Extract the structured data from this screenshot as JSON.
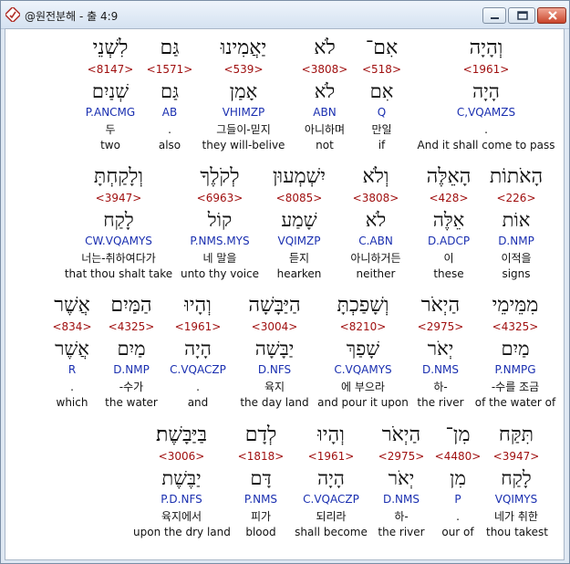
{
  "window": {
    "title": "@원전분해 - 출 4:9"
  },
  "rows": [
    [
      {
        "heb": "וְהָיָה",
        "strong": "<1961>",
        "lemma": "הָיָה",
        "parse": "C,VQAMZS",
        "kor": ".",
        "eng": "And it shall come to pass"
      },
      {
        "heb": "אִם־",
        "strong": "<518>",
        "lemma": "אִם",
        "parse": "Q",
        "kor": "만일",
        "eng": "if"
      },
      {
        "heb": "לֹא",
        "strong": "<3808>",
        "lemma": "לֹא",
        "parse": "ABN",
        "kor": "아니하며",
        "eng": "not"
      },
      {
        "heb": "יַאֲמִינוּ",
        "strong": "<539>",
        "lemma": "אָמַן",
        "parse": "VHIMZP",
        "kor": "그들이-믿지",
        "eng": "they will-belive"
      },
      {
        "heb": "גַּם",
        "strong": "<1571>",
        "lemma": "גַּם",
        "parse": "AB",
        "kor": ".",
        "eng": "also"
      },
      {
        "heb": "לִשְׁנֵי",
        "strong": "<8147>",
        "lemma": "שְׁנַיִם",
        "parse": "P.ANCMG",
        "kor": "두",
        "eng": "two"
      }
    ],
    [
      {
        "heb": "הָאֹתוֹת",
        "strong": "<226>",
        "lemma": "אוֹת",
        "parse": "D.NMP",
        "kor": "이적을",
        "eng": "signs"
      },
      {
        "heb": "הָאֵלֶּה",
        "strong": "<428>",
        "lemma": "אֵלֶּה",
        "parse": "D.ADCP",
        "kor": "이",
        "eng": "these"
      },
      {
        "heb": "וְלֹא",
        "strong": "<3808>",
        "lemma": "לֹא",
        "parse": "C.ABN",
        "kor": "아니하거든",
        "eng": "neither"
      },
      {
        "heb": "יִשְׁמְעוּן",
        "strong": "<8085>",
        "lemma": "שָׁמַע",
        "parse": "VQIMZP",
        "kor": "듣지",
        "eng": "hearken"
      },
      {
        "heb": "לְקֹלֶךָ",
        "strong": "<6963>",
        "lemma": "קוֹל",
        "parse": "P.NMS.MYS",
        "kor": "네 말을",
        "eng": "unto thy voice"
      },
      {
        "heb": "וְלָקַחְתָּ",
        "strong": "<3947>",
        "lemma": "לָקַח",
        "parse": "CW.VQAMYS",
        "kor": "너는-취하여다가",
        "eng": "that thou shalt take"
      }
    ],
    [
      {
        "heb": "מִמֵּימֵי",
        "strong": "<4325>",
        "lemma": "מַיִם",
        "parse": "P.NMPG",
        "kor": "-수를 조금",
        "eng": "of the water of"
      },
      {
        "heb": "הַיְאֹר",
        "strong": "<2975>",
        "lemma": "יְאֹר",
        "parse": "D.NMS",
        "kor": "하-",
        "eng": "the river"
      },
      {
        "heb": "וְשָׁפַכְתָּ",
        "strong": "<8210>",
        "lemma": "שָׁפַךְ",
        "parse": "C.VQAMYS",
        "kor": "에 부으라",
        "eng": "and pour it upon"
      },
      {
        "heb": "הַיַּבָּשָׁה",
        "strong": "<3004>",
        "lemma": "יַבָּשָׁה",
        "parse": "D.NFS",
        "kor": "육지",
        "eng": "the day land"
      },
      {
        "heb": "וְהָיוּ",
        "strong": "<1961>",
        "lemma": "הָיָה",
        "parse": "C.VQACZP",
        "kor": ".",
        "eng": "and"
      },
      {
        "heb": "הַמַּיִם",
        "strong": "<4325>",
        "lemma": "מַיִם",
        "parse": "D.NMP",
        "kor": "-수가",
        "eng": "the water"
      },
      {
        "heb": "אֲשֶׁר",
        "strong": "<834>",
        "lemma": "אֲשֶׁר",
        "parse": "R",
        "kor": ".",
        "eng": "which"
      }
    ],
    [
      {
        "heb": "תִּקַּח",
        "strong": "<3947>",
        "lemma": "לָקַח",
        "parse": "VQIMYS",
        "kor": "네가 취한",
        "eng": "thou takest"
      },
      {
        "heb": "מִן־",
        "strong": "<4480>",
        "lemma": "מִן",
        "parse": "P",
        "kor": ".",
        "eng": "our of"
      },
      {
        "heb": "הַיְאֹר",
        "strong": "<2975>",
        "lemma": "יְאֹר",
        "parse": "D.NMS",
        "kor": "하-",
        "eng": "the river"
      },
      {
        "heb": "וְהָיוּ",
        "strong": "<1961>",
        "lemma": "הָיָה",
        "parse": "C.VQACZP",
        "kor": "되리라",
        "eng": "shall become"
      },
      {
        "heb": "לְדָם",
        "strong": "<1818>",
        "lemma": "דָּם",
        "parse": "P.NMS",
        "kor": "피가",
        "eng": "blood"
      },
      {
        "heb": "בַּיַּבָּשֶׁת׃",
        "strong": "<3006>",
        "lemma": "יַבֶּשֶׁת",
        "parse": "P.D.NFS",
        "kor": "육지에서",
        "eng": "upon the dry land"
      }
    ]
  ]
}
